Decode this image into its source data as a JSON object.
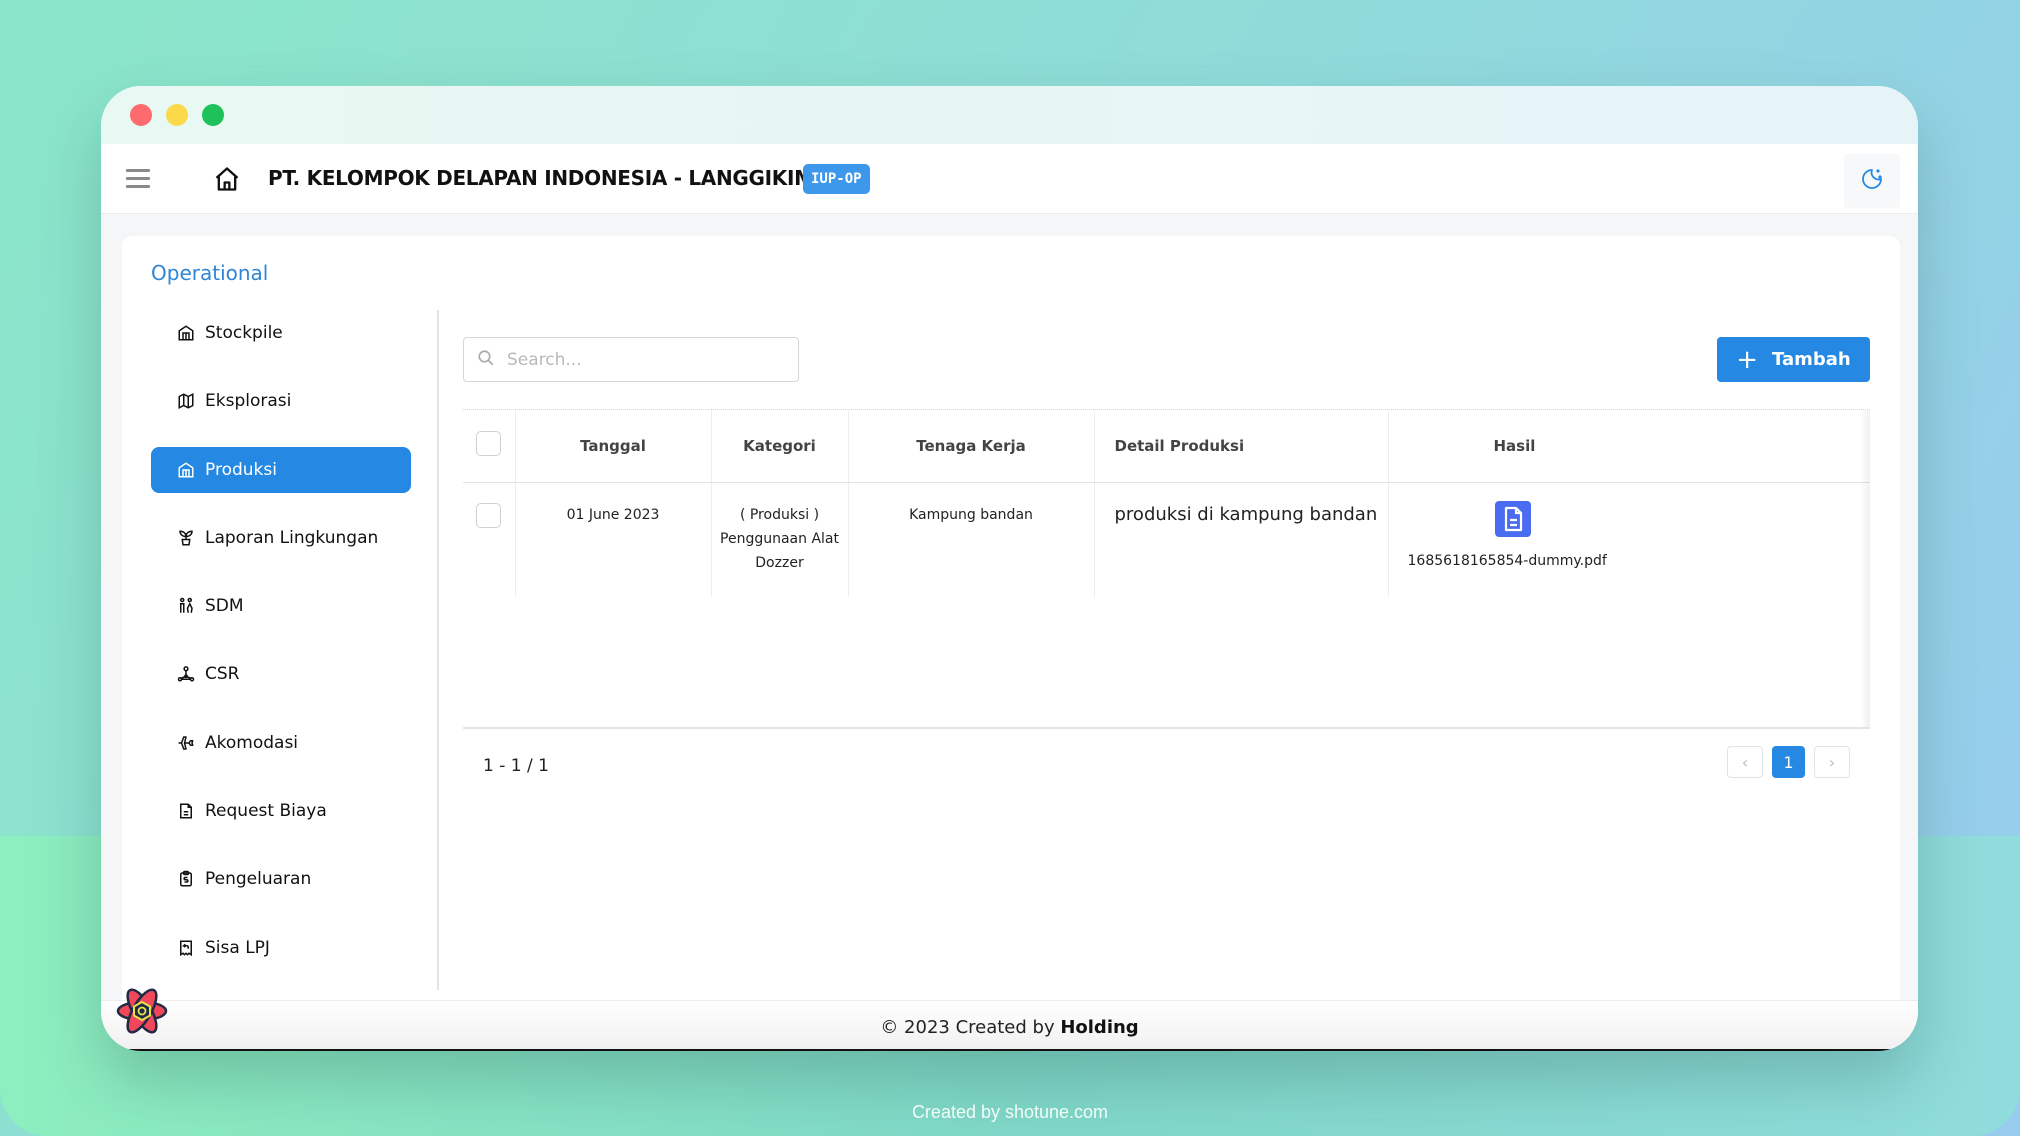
{
  "window": {
    "traffic_lights": [
      "close",
      "minimize",
      "maximize"
    ],
    "colors": {
      "close": "#fe6b6f",
      "minimize": "#fcd948",
      "maximize": "#1fc25a"
    }
  },
  "header": {
    "menu_icon": "hamburger-icon",
    "home_icon": "home-icon",
    "company_name": "PT. KELOMPOK DELAPAN INDONESIA - LANGGIKIMA",
    "badge": "IUP-OP",
    "theme_toggle_icon": "moon-stars-icon"
  },
  "sidebar": {
    "section_title": "Operational",
    "items": [
      {
        "label": "Stockpile",
        "icon": "building-icon",
        "active": false
      },
      {
        "label": "Eksplorasi",
        "icon": "map-icon",
        "active": false
      },
      {
        "label": "Produksi",
        "icon": "building-icon",
        "active": true
      },
      {
        "label": "Laporan Lingkungan",
        "icon": "plant-icon",
        "active": false
      },
      {
        "label": "SDM",
        "icon": "people-icon",
        "active": false
      },
      {
        "label": "CSR",
        "icon": "network-icon",
        "active": false
      },
      {
        "label": "Akomodasi",
        "icon": "plane-icon",
        "active": false
      },
      {
        "label": "Request Biaya",
        "icon": "document-icon",
        "active": false
      },
      {
        "label": "Pengeluaran",
        "icon": "clipboard-dollar-icon",
        "active": false
      },
      {
        "label": "Sisa LPJ",
        "icon": "receipt-refund-icon",
        "active": false
      }
    ]
  },
  "toolbar": {
    "search_placeholder": "Search...",
    "search_value": "",
    "add_label": "Tambah"
  },
  "table": {
    "columns": [
      "Tanggal",
      "Kategori",
      "Tenaga Kerja",
      "Detail Produksi",
      "Hasil"
    ],
    "rows": [
      {
        "checked": false,
        "tanggal": "01 June 2023",
        "kategori_line1": "( Produksi )",
        "kategori_line2": "Penggunaan Alat",
        "kategori_line3": "Dozzer",
        "tenaga_kerja": "Kampung bandan",
        "detail_produksi": "produksi di kampung bandan",
        "hasil_icon": "file-document-icon",
        "hasil_filename": "1685618165854-dummy.pdf"
      }
    ]
  },
  "pagination": {
    "range_text": "1 - 1 / 1",
    "prev_label": "‹",
    "current_page": "1",
    "next_label": "›"
  },
  "footer": {
    "prefix": "© 2023 Created by ",
    "brand": "Holding"
  },
  "watermark": "Created by shotune.com",
  "colors": {
    "primary": "#2589e3",
    "section_title": "#2d86d6",
    "badge": "#3d97ea",
    "file_icon": "#4a6cf0"
  }
}
